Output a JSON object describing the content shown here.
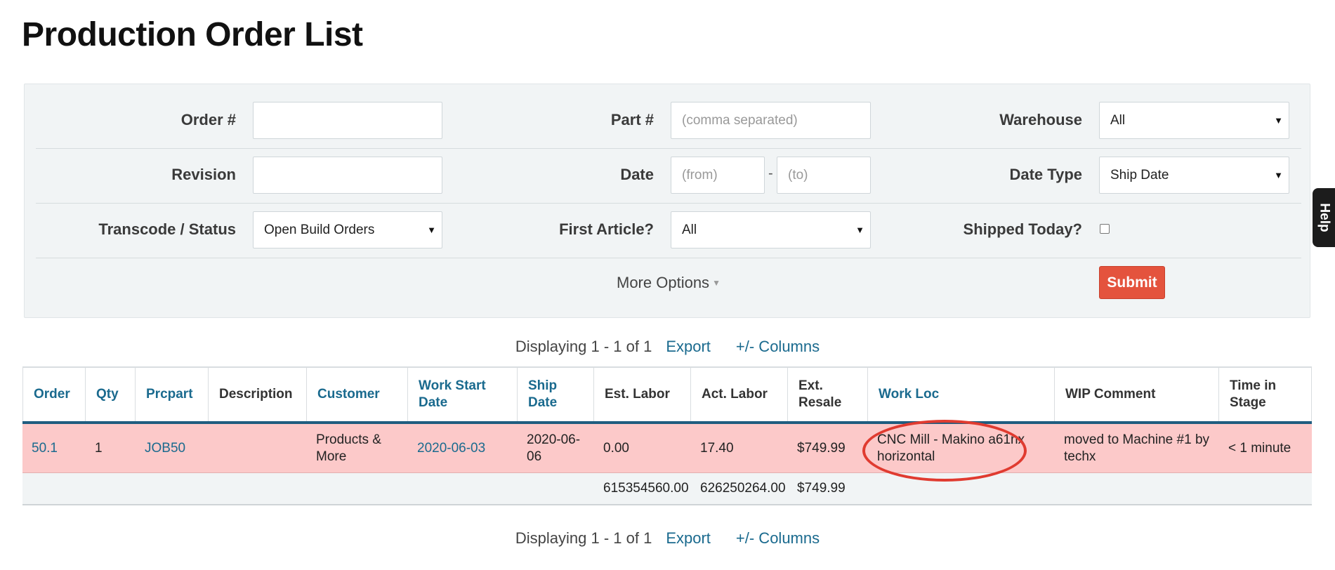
{
  "page": {
    "title": "Production Order List"
  },
  "filters": {
    "order_label": "Order #",
    "order_value": "",
    "part_label": "Part #",
    "part_placeholder": "(comma separated)",
    "warehouse_label": "Warehouse",
    "warehouse_value": "All",
    "revision_label": "Revision",
    "revision_value": "",
    "date_label": "Date",
    "date_from_placeholder": "(from)",
    "date_to_placeholder": "(to)",
    "date_separator": "-",
    "date_type_label": "Date Type",
    "date_type_value": "Ship Date",
    "transcode_label": "Transcode / Status",
    "transcode_value": "Open Build Orders",
    "first_article_label": "First Article?",
    "first_article_value": "All",
    "shipped_today_label": "Shipped Today?",
    "shipped_today_checked": false,
    "more_options_label": "More Options",
    "submit_label": "Submit"
  },
  "pagination_top": {
    "displaying": "Displaying 1 - 1 of 1",
    "export": "Export",
    "columns": "+/- Columns"
  },
  "pagination_bottom": {
    "displaying": "Displaying 1 - 1 of 1",
    "export": "Export",
    "columns": "+/- Columns"
  },
  "table": {
    "headers": {
      "order": "Order",
      "qty": "Qty",
      "prcpart": "Prcpart",
      "description": "Description",
      "customer": "Customer",
      "work_start_date": "Work Start Date",
      "ship_date": "Ship Date",
      "est_labor": "Est. Labor",
      "act_labor": "Act. Labor",
      "ext_resale": "Ext. Resale",
      "work_loc": "Work Loc",
      "wip_comment": "WIP Comment",
      "time_in_stage": "Time in Stage"
    },
    "rows": [
      {
        "order": "50.1",
        "qty": "1",
        "prcpart": "JOB50",
        "description": "",
        "customer": "Products & More",
        "work_start_date": "2020-06-03",
        "ship_date": "2020-06-06",
        "est_labor": "0.00",
        "act_labor": "17.40",
        "ext_resale": "$749.99",
        "work_loc": "CNC Mill - Makino a61nx horizontal",
        "wip_comment": "moved to Machine #1 by techx",
        "time_in_stage": "< 1 minute"
      }
    ],
    "totals": {
      "est_labor": "615354560.00",
      "act_labor": "626250264.00",
      "ext_resale": "$749.99"
    }
  },
  "help_tab": {
    "label": "Help"
  },
  "colors": {
    "accent": "#1a6a8e",
    "submit": "#e4533d",
    "row_highlight": "#fcc9c9",
    "annotation": "#e03b30"
  }
}
